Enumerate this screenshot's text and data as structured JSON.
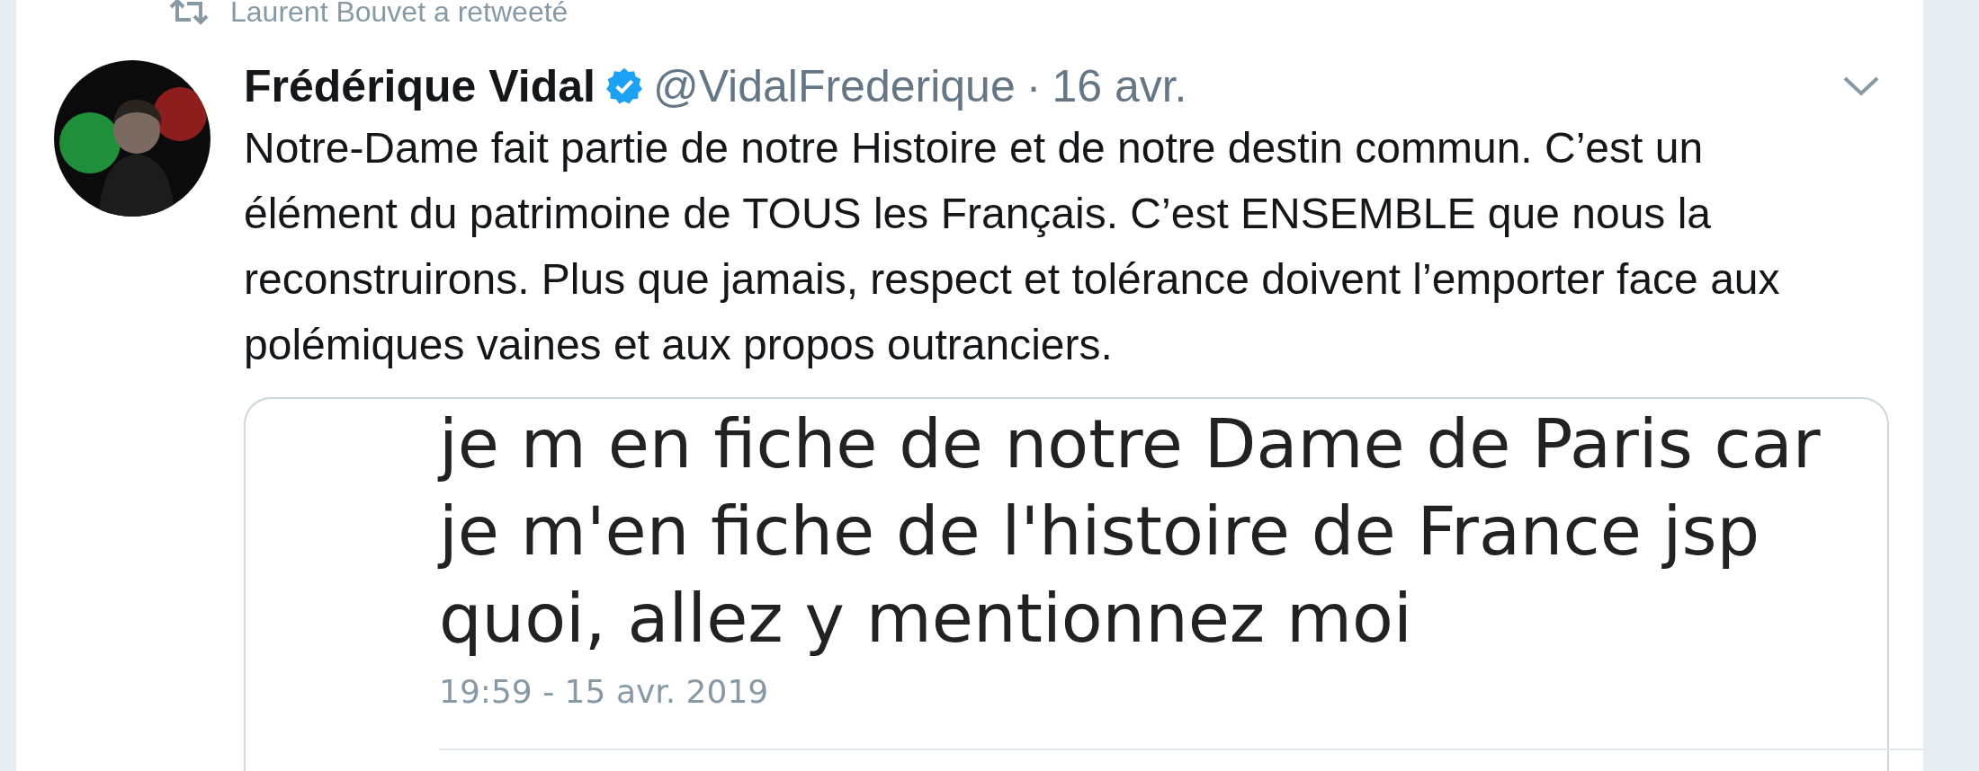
{
  "retweet_banner": {
    "text": "Laurent Bouvet a retweeté"
  },
  "tweet": {
    "author_name": "Frédérique Vidal",
    "verified": true,
    "handle": "@VidalFrederique",
    "separator": "·",
    "date": "16 avr.",
    "text": "Notre-Dame fait partie de notre Histoire et de notre destin commun. C’est un élément du patrimoine de TOUS les Français. C’est ENSEMBLE que nous la reconstruirons. Plus que jamais, respect et tolérance doivent l’emporter face aux polémiques vaines et aux propos outranciers.",
    "quoted_tweet": {
      "lines": [
        "je m en fiche de notre Dame de Paris car",
        "je m'en fiche de l'histoire de France jsp",
        "quoi, allez y mentionnez moi"
      ],
      "timestamp": "19:59 - 15 avr. 2019"
    }
  }
}
